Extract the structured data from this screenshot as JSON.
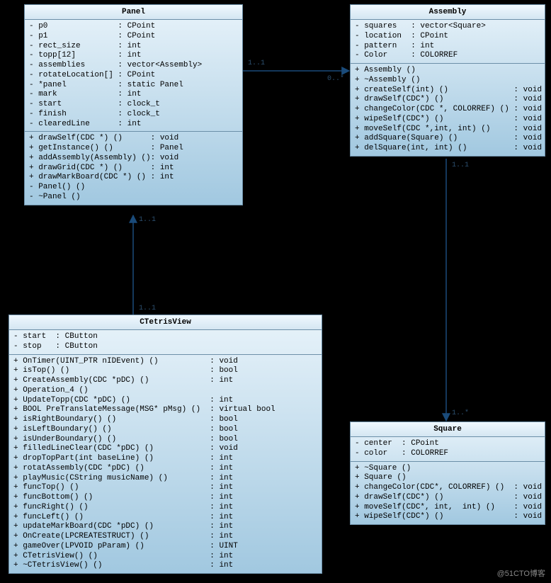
{
  "watermark": "@51CTO博客",
  "classes": {
    "panel": {
      "name": "Panel",
      "attrs": [
        {
          "vis": "-",
          "name": "p0",
          "type": "CPoint"
        },
        {
          "vis": "-",
          "name": "p1",
          "type": "CPoint"
        },
        {
          "vis": "-",
          "name": "rect_size",
          "type": "int"
        },
        {
          "vis": "-",
          "name": "topp[12]",
          "type": "int"
        },
        {
          "vis": "-",
          "name": "assemblies",
          "type": "vector<Assembly>"
        },
        {
          "vis": "-",
          "name": "rotateLocation[]",
          "type": "CPoint"
        },
        {
          "vis": "-",
          "name": "*panel",
          "type": "static Panel"
        },
        {
          "vis": "-",
          "name": "mark",
          "type": "int"
        },
        {
          "vis": "-",
          "name": "start",
          "type": "clock_t"
        },
        {
          "vis": "-",
          "name": "finish",
          "type": "clock_t"
        },
        {
          "vis": "-",
          "name": "clearedLine",
          "type": "int"
        }
      ],
      "ops": [
        {
          "vis": "+",
          "sig": "drawSelf(CDC *) ()",
          "ret": "void"
        },
        {
          "vis": "+",
          "sig": "getInstance() ()",
          "ret": "Panel"
        },
        {
          "vis": "+",
          "sig": "addAssembly(Assembly) ()",
          "ret": "void"
        },
        {
          "vis": "+",
          "sig": "drawGrid(CDC *) ()",
          "ret": "int"
        },
        {
          "vis": "+",
          "sig": "drawMarkBoard(CDC *) ()",
          "ret": "int"
        },
        {
          "vis": "-",
          "sig": "Panel() ()",
          "ret": ""
        },
        {
          "vis": "-",
          "sig": "~Panel ()",
          "ret": ""
        }
      ]
    },
    "assembly": {
      "name": "Assembly",
      "attrs": [
        {
          "vis": "-",
          "name": "squares",
          "type": "vector<Square>"
        },
        {
          "vis": "-",
          "name": "location",
          "type": "CPoint"
        },
        {
          "vis": "-",
          "name": "pattern",
          "type": "int"
        },
        {
          "vis": "-",
          "name": "Color",
          "type": "COLORREF"
        }
      ],
      "ops": [
        {
          "vis": "+",
          "sig": "Assembly ()",
          "ret": ""
        },
        {
          "vis": "+",
          "sig": "~Assembly ()",
          "ret": ""
        },
        {
          "vis": "+",
          "sig": "createSelf(int) ()",
          "ret": "void"
        },
        {
          "vis": "+",
          "sig": "drawSelf(CDC*) ()",
          "ret": "void"
        },
        {
          "vis": "+",
          "sig": "changeColor(CDC *, COLORREF) ()",
          "ret": "void"
        },
        {
          "vis": "+",
          "sig": "wipeSelf(CDC*) ()",
          "ret": "void"
        },
        {
          "vis": "+",
          "sig": "moveSelf(CDC *,int, int) ()",
          "ret": "void"
        },
        {
          "vis": "+",
          "sig": "addSquare(Square) ()",
          "ret": "void"
        },
        {
          "vis": "+",
          "sig": "delSquare(int, int) ()",
          "ret": "void"
        }
      ]
    },
    "ctetris": {
      "name": "CTetrisView",
      "attrs": [
        {
          "vis": "-",
          "name": "start",
          "type": "CButton"
        },
        {
          "vis": "-",
          "name": "stop",
          "type": "CButton"
        }
      ],
      "ops": [
        {
          "vis": "+",
          "sig": "OnTimer(UINT_PTR nIDEvent) ()",
          "ret": "void"
        },
        {
          "vis": "+",
          "sig": "isTop() ()",
          "ret": "bool"
        },
        {
          "vis": "+",
          "sig": "CreateAssembly(CDC *pDC) ()",
          "ret": "int"
        },
        {
          "vis": "+",
          "sig": "Operation_4 ()",
          "ret": ""
        },
        {
          "vis": "+",
          "sig": "UpdateTopp(CDC *pDC) ()",
          "ret": "int"
        },
        {
          "vis": "+",
          "sig": "BOOL PreTranslateMessage(MSG* pMsg) ()",
          "ret": "virtual bool"
        },
        {
          "vis": "+",
          "sig": "isRightBoundary() ()",
          "ret": "bool"
        },
        {
          "vis": "+",
          "sig": "isLeftBoundary() ()",
          "ret": "bool"
        },
        {
          "vis": "+",
          "sig": "isUnderBoundary() ()",
          "ret": "bool"
        },
        {
          "vis": "+",
          "sig": "filledLineClear(CDC *pDC) ()",
          "ret": "void"
        },
        {
          "vis": "+",
          "sig": "dropTopPart(int baseLine) ()",
          "ret": "int"
        },
        {
          "vis": "+",
          "sig": "rotatAssembly(CDC *pDC) ()",
          "ret": "int"
        },
        {
          "vis": "+",
          "sig": "playMusic(CString musicName) ()",
          "ret": "int"
        },
        {
          "vis": "+",
          "sig": "funcTop() ()",
          "ret": "int"
        },
        {
          "vis": "+",
          "sig": "funcBottom() ()",
          "ret": "int"
        },
        {
          "vis": "+",
          "sig": "funcRight() ()",
          "ret": "int"
        },
        {
          "vis": "+",
          "sig": "funcLeft() ()",
          "ret": "int"
        },
        {
          "vis": "+",
          "sig": "updateMarkBoard(CDC *pDC) ()",
          "ret": "int"
        },
        {
          "vis": "+",
          "sig": "OnCreate(LPCREATESTRUCT) ()",
          "ret": "int"
        },
        {
          "vis": "+",
          "sig": "gameOver(LPVOID pParam) ()",
          "ret": "UINT"
        },
        {
          "vis": "+",
          "sig": "CTetrisView() ()",
          "ret": "int"
        },
        {
          "vis": "+",
          "sig": "~CTetrisView() ()",
          "ret": "int"
        }
      ]
    },
    "square": {
      "name": "Square",
      "attrs": [
        {
          "vis": "-",
          "name": "center",
          "type": "CPoint"
        },
        {
          "vis": "-",
          "name": "color",
          "type": "COLORREF"
        }
      ],
      "ops": [
        {
          "vis": "+",
          "sig": "~Square ()",
          "ret": ""
        },
        {
          "vis": "+",
          "sig": "Square ()",
          "ret": ""
        },
        {
          "vis": "+",
          "sig": "changeColor(CDC*, COLORREF) ()",
          "ret": "void"
        },
        {
          "vis": "+",
          "sig": "drawSelf(CDC*) ()",
          "ret": "void"
        },
        {
          "vis": "+",
          "sig": "moveSelf(CDC*, int,  int) ()",
          "ret": "void"
        },
        {
          "vis": "+",
          "sig": "wipeSelf(CDC*) ()",
          "ret": "void"
        }
      ]
    }
  },
  "multiplicities": {
    "panel_assembly_src": "1..1",
    "panel_assembly_dst": "0..*",
    "ctetris_panel_src": "1..1",
    "ctetris_panel_dst": "1..1",
    "assembly_square_src": "1..1",
    "assembly_square_dst": "1..*"
  }
}
